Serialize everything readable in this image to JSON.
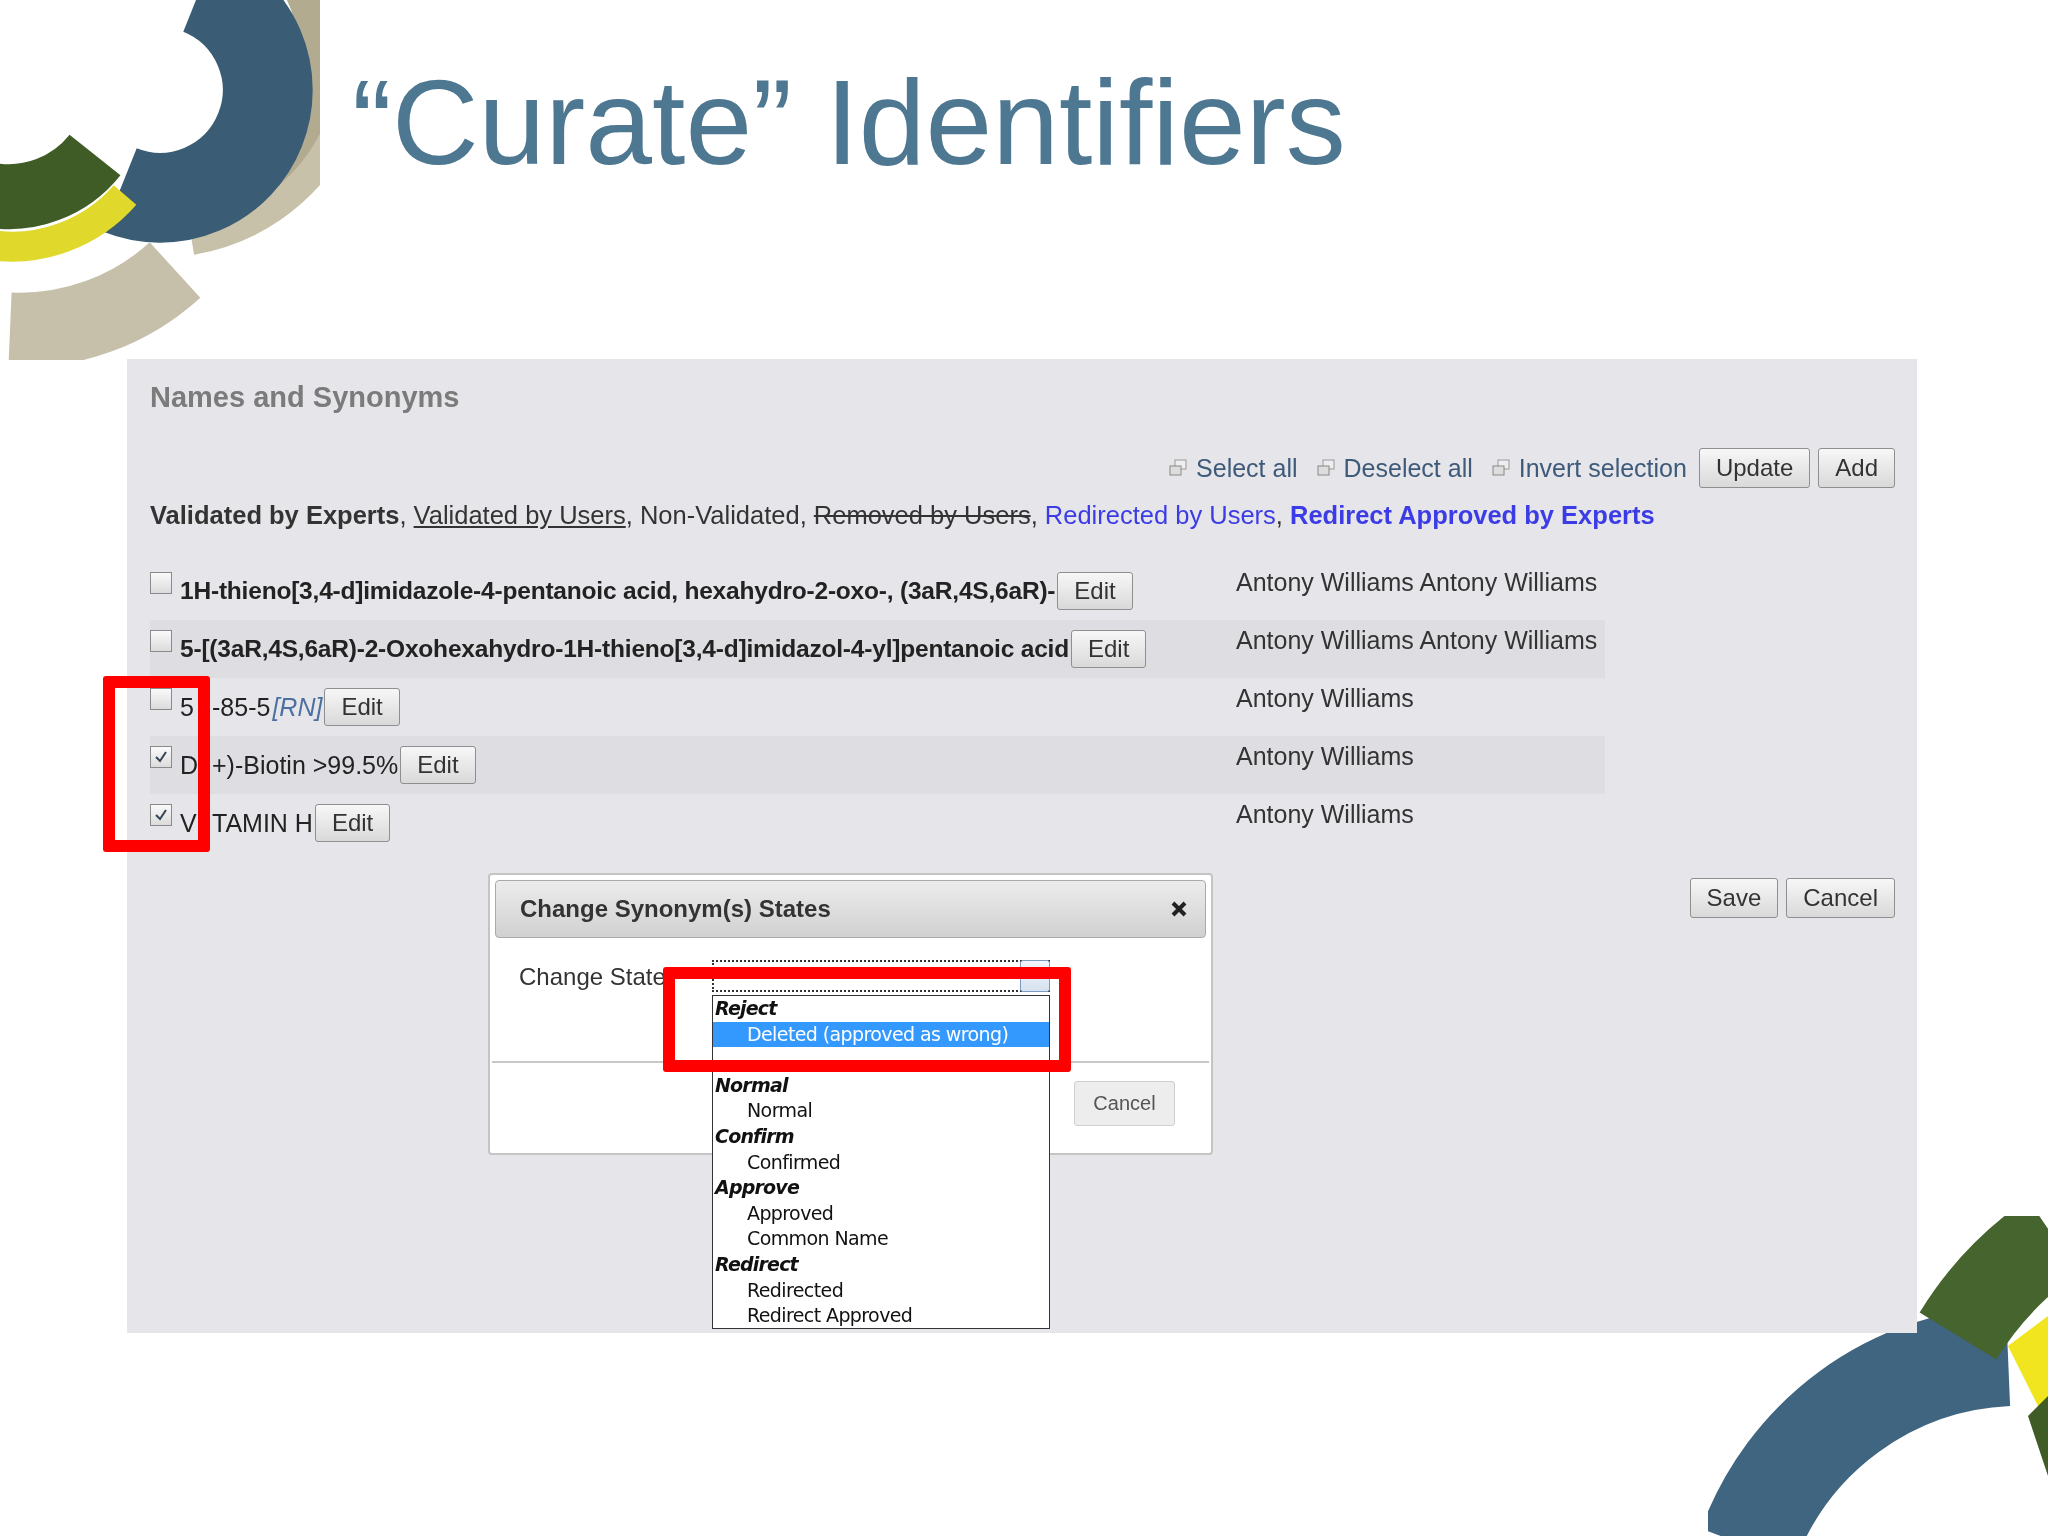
{
  "slide_title": "“Curate” Identifiers",
  "panel": {
    "heading": "Names and Synonyms",
    "toolbar": {
      "links": [
        "Select all",
        "Deselect all",
        "Invert selection"
      ],
      "buttons": [
        "Update",
        "Add"
      ]
    },
    "legend": {
      "separator": ", ",
      "items": [
        {
          "text": "Validated by Experts",
          "kind": "bold"
        },
        {
          "text": "Validated by Users",
          "kind": "underline"
        },
        {
          "text": "Non-Validated",
          "kind": "plain"
        },
        {
          "text": "Removed by Users",
          "kind": "strike"
        },
        {
          "text": "Redirected by Users",
          "kind": "link"
        },
        {
          "text": "Redirect Approved by Experts",
          "kind": "boldlink"
        }
      ]
    },
    "rows": [
      {
        "name": "1H-thieno[3,4-d]imidazole-4-pentanoic acid, hexahydro-2-oxo-, (3aR,4S,6aR)-",
        "bold": true,
        "checked": false,
        "edit": "Edit",
        "authors": "Antony Williams Antony Williams"
      },
      {
        "name": "5-[(3aR,4S,6aR)-2-Oxohexahydro-1H-thieno[3,4-d]imidazol-4-yl]pentanoic acid",
        "bold": true,
        "checked": false,
        "edit": "Edit",
        "authors": "Antony Williams Antony Williams"
      },
      {
        "name_parts": [
          "5",
          "-85-5"
        ],
        "tag": "[RN]",
        "bold": false,
        "checked": false,
        "edit": "Edit",
        "authors": "Antony Williams"
      },
      {
        "name_parts": [
          "D",
          "+)-Biotin >99.5%"
        ],
        "bold": false,
        "checked": true,
        "edit": "Edit",
        "authors": "Antony Williams"
      },
      {
        "name_parts": [
          "V",
          "TAMIN H"
        ],
        "bold": false,
        "checked": true,
        "edit": "Edit",
        "authors": "Antony Williams"
      }
    ],
    "footer_buttons": [
      "Save",
      "Cancel"
    ],
    "dialog": {
      "title": "Change Synonym(s) States",
      "label": "Change State",
      "cancel": "Cancel",
      "options": [
        {
          "kind": "group",
          "label": "Reject"
        },
        {
          "kind": "option",
          "label": "Deleted (approved as wrong)",
          "selected": true
        },
        {
          "kind": "covered"
        },
        {
          "kind": "group",
          "label": "Normal"
        },
        {
          "kind": "option",
          "label": "Normal",
          "selected": false
        },
        {
          "kind": "group",
          "label": "Confirm"
        },
        {
          "kind": "option",
          "label": "Confirmed",
          "selected": false
        },
        {
          "kind": "group",
          "label": "Approve"
        },
        {
          "kind": "option",
          "label": "Approved",
          "selected": false
        },
        {
          "kind": "option",
          "label": "Common Name",
          "selected": false
        },
        {
          "kind": "group",
          "label": "Redirect"
        },
        {
          "kind": "option",
          "label": "Redirected",
          "selected": false
        },
        {
          "kind": "option",
          "label": "Redirect Approved",
          "selected": false
        }
      ]
    }
  }
}
